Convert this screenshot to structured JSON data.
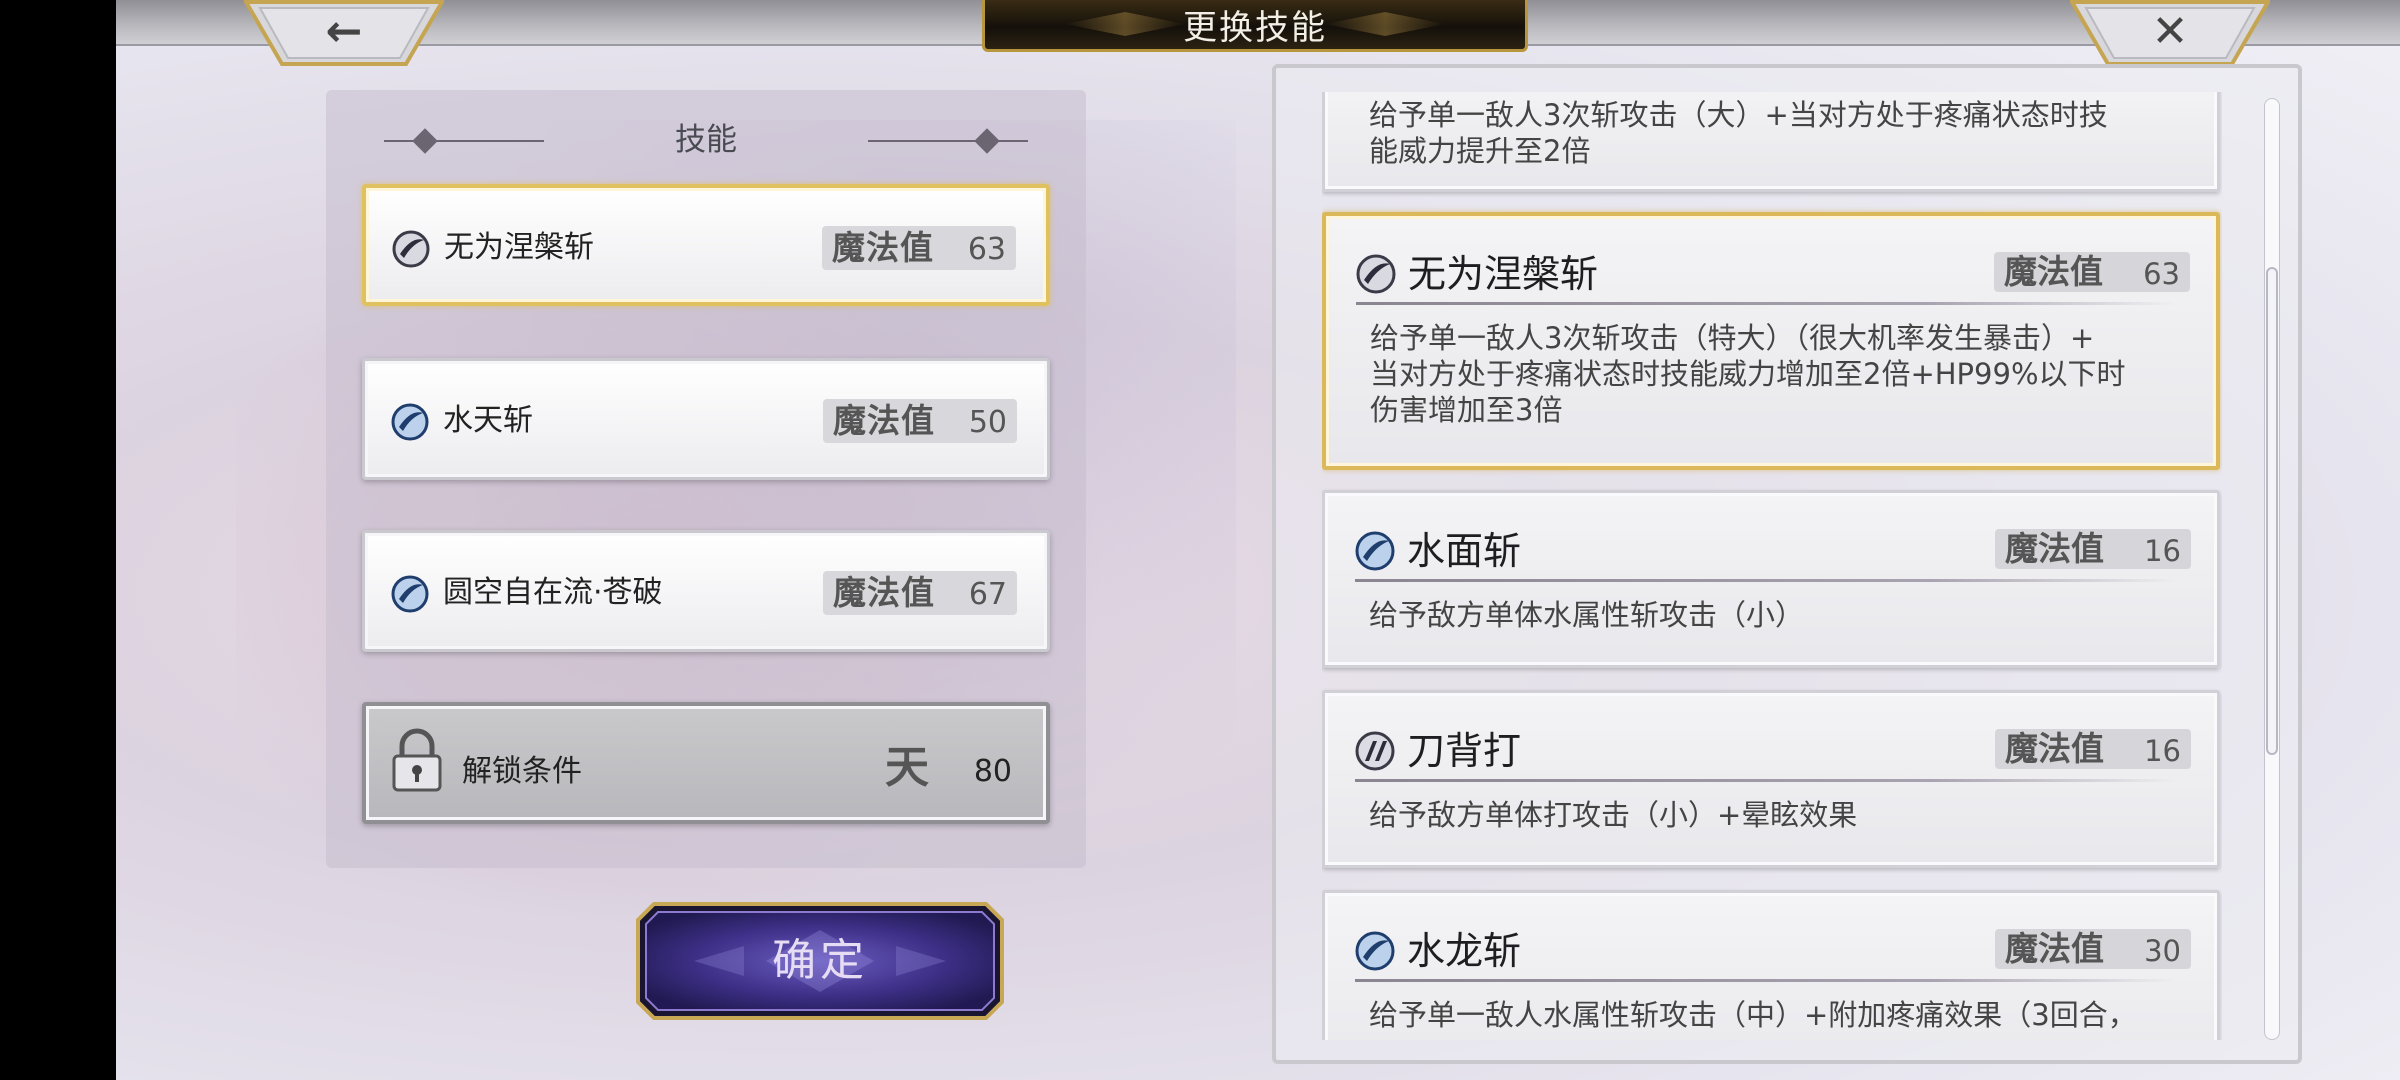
{
  "title": "更换技能",
  "top_buttons": {
    "back_glyph": "←",
    "close_glyph": "✕"
  },
  "left_panel": {
    "header": "技能",
    "slots": [
      {
        "name": "无为涅槃斩",
        "mana_label": "魔法值",
        "mana": "63",
        "icon": "slash-skill-icon",
        "selected": true
      },
      {
        "name": "水天斩",
        "mana_label": "魔法值",
        "mana": "50",
        "icon": "water-slash-skill-icon",
        "selected": false
      },
      {
        "name": "圆空自在流·苍破",
        "mana_label": "魔法值",
        "mana": "67",
        "icon": "water-slash-skill-icon",
        "selected": false
      }
    ],
    "locked_slot": {
      "name": "解锁条件",
      "glyph": "天",
      "value": "80",
      "icon": "lock-icon"
    }
  },
  "confirm_label": "确定",
  "right_panel": {
    "partial_top_desc": [
      "给予单一敌人3次斩攻击（大）+当对方处于疼痛状态时技",
      "能威力提升至2倍"
    ],
    "cards": [
      {
        "name": "无为涅槃斩",
        "mana_label": "魔法值",
        "mana": "63",
        "icon": "slash-skill-icon",
        "selected": true,
        "desc": [
          "给予单一敌人3次斩攻击（特大）（很大机率发生暴击）+",
          "当对方处于疼痛状态时技能威力增加至2倍+HP99%以下时",
          "伤害增加至3倍"
        ]
      },
      {
        "name": "水面斩",
        "mana_label": "魔法值",
        "mana": "16",
        "icon": "water-slash-skill-icon",
        "selected": false,
        "desc": [
          "给予敌方单体水属性斩攻击（小）"
        ]
      },
      {
        "name": "刀背打",
        "mana_label": "魔法值",
        "mana": "16",
        "icon": "strike-skill-icon",
        "selected": false,
        "desc": [
          "给予敌方单体打攻击（小）+晕眩效果"
        ]
      },
      {
        "name": "水龙斩",
        "mana_label": "魔法值",
        "mana": "30",
        "icon": "water-slash-skill-icon",
        "selected": false,
        "desc": [
          "给予单一敌人水属性斩攻击（中）+附加疼痛效果（3回合，"
        ]
      }
    ]
  },
  "colors": {
    "selected_border": "#dbb85a",
    "title_plate": "#14100a",
    "confirm_button": "#3d2f86"
  }
}
